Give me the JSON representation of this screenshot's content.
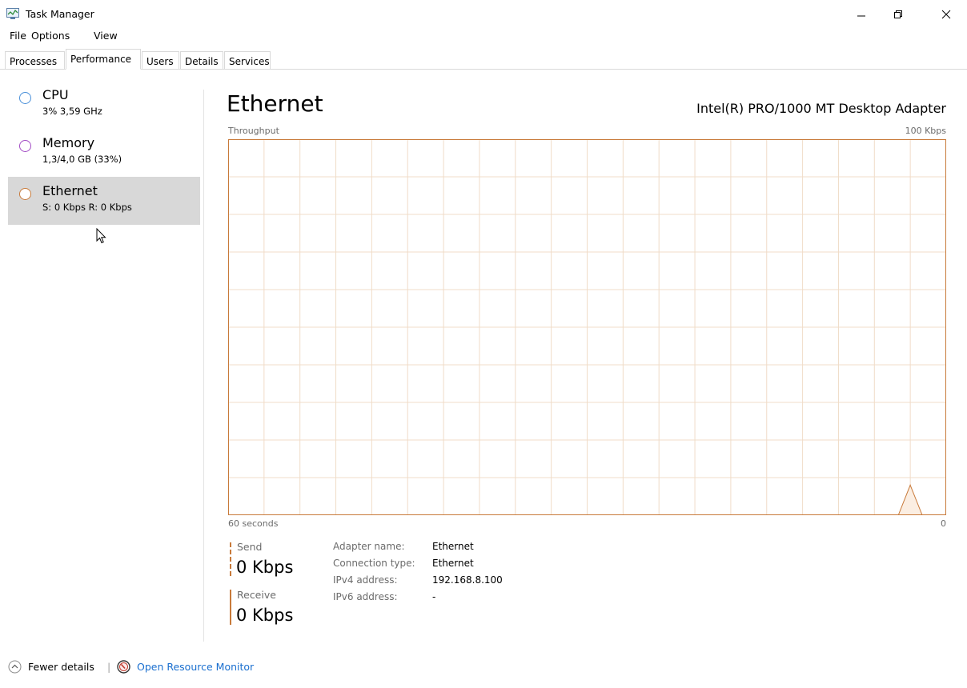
{
  "window": {
    "title": "Task Manager"
  },
  "menu": [
    "File",
    "Options",
    "View"
  ],
  "tabs": [
    {
      "label": "Processes",
      "active": false
    },
    {
      "label": "Performance",
      "active": true
    },
    {
      "label": "Users",
      "active": false
    },
    {
      "label": "Details",
      "active": false
    },
    {
      "label": "Services",
      "active": false
    }
  ],
  "sidebar": {
    "items": [
      {
        "name": "CPU",
        "sub": "3% 3,59 GHz",
        "color": "#4a90d9",
        "selected": false
      },
      {
        "name": "Memory",
        "sub": "1,3/4,0 GB (33%)",
        "color": "#a24bc4",
        "selected": false
      },
      {
        "name": "Ethernet",
        "sub": "S: 0 Kbps R: 0 Kbps",
        "color": "#c87a3a",
        "selected": true
      }
    ]
  },
  "main": {
    "title": "Ethernet",
    "adapter": "Intel(R) PRO/1000 MT Desktop Adapter",
    "graph_label": "Throughput",
    "graph_max": "100 Kbps",
    "graph_time": "60 seconds",
    "graph_min": "0"
  },
  "chart_data": {
    "type": "area",
    "series": [
      {
        "values": [
          0,
          0,
          0,
          0,
          0,
          0,
          0,
          0,
          0,
          0,
          0,
          0,
          0,
          0,
          0,
          0,
          0,
          0,
          0,
          0,
          0,
          0,
          0,
          0,
          0,
          0,
          0,
          0,
          0,
          0,
          0,
          0,
          0,
          0,
          0,
          0,
          0,
          0,
          0,
          0,
          0,
          0,
          0,
          0,
          0,
          0,
          0,
          0,
          0,
          0,
          0,
          0,
          0,
          0,
          0,
          0,
          0,
          8,
          0,
          0,
          0
        ]
      }
    ],
    "ylim": [
      0,
      100
    ],
    "grid": true,
    "color": "#c87a3a"
  },
  "stats": {
    "send_label": "Send",
    "send_value": "0 Kbps",
    "receive_label": "Receive",
    "receive_value": "0 Kbps"
  },
  "info": [
    {
      "label": "Adapter name:",
      "value": "Ethernet"
    },
    {
      "label": "Connection type:",
      "value": "Ethernet"
    },
    {
      "label": "IPv4 address:",
      "value": "192.168.8.100"
    },
    {
      "label": "IPv6 address:",
      "value": "-"
    }
  ],
  "footer": {
    "fewer_details": "Fewer details",
    "resource_monitor": "Open Resource Monitor"
  }
}
